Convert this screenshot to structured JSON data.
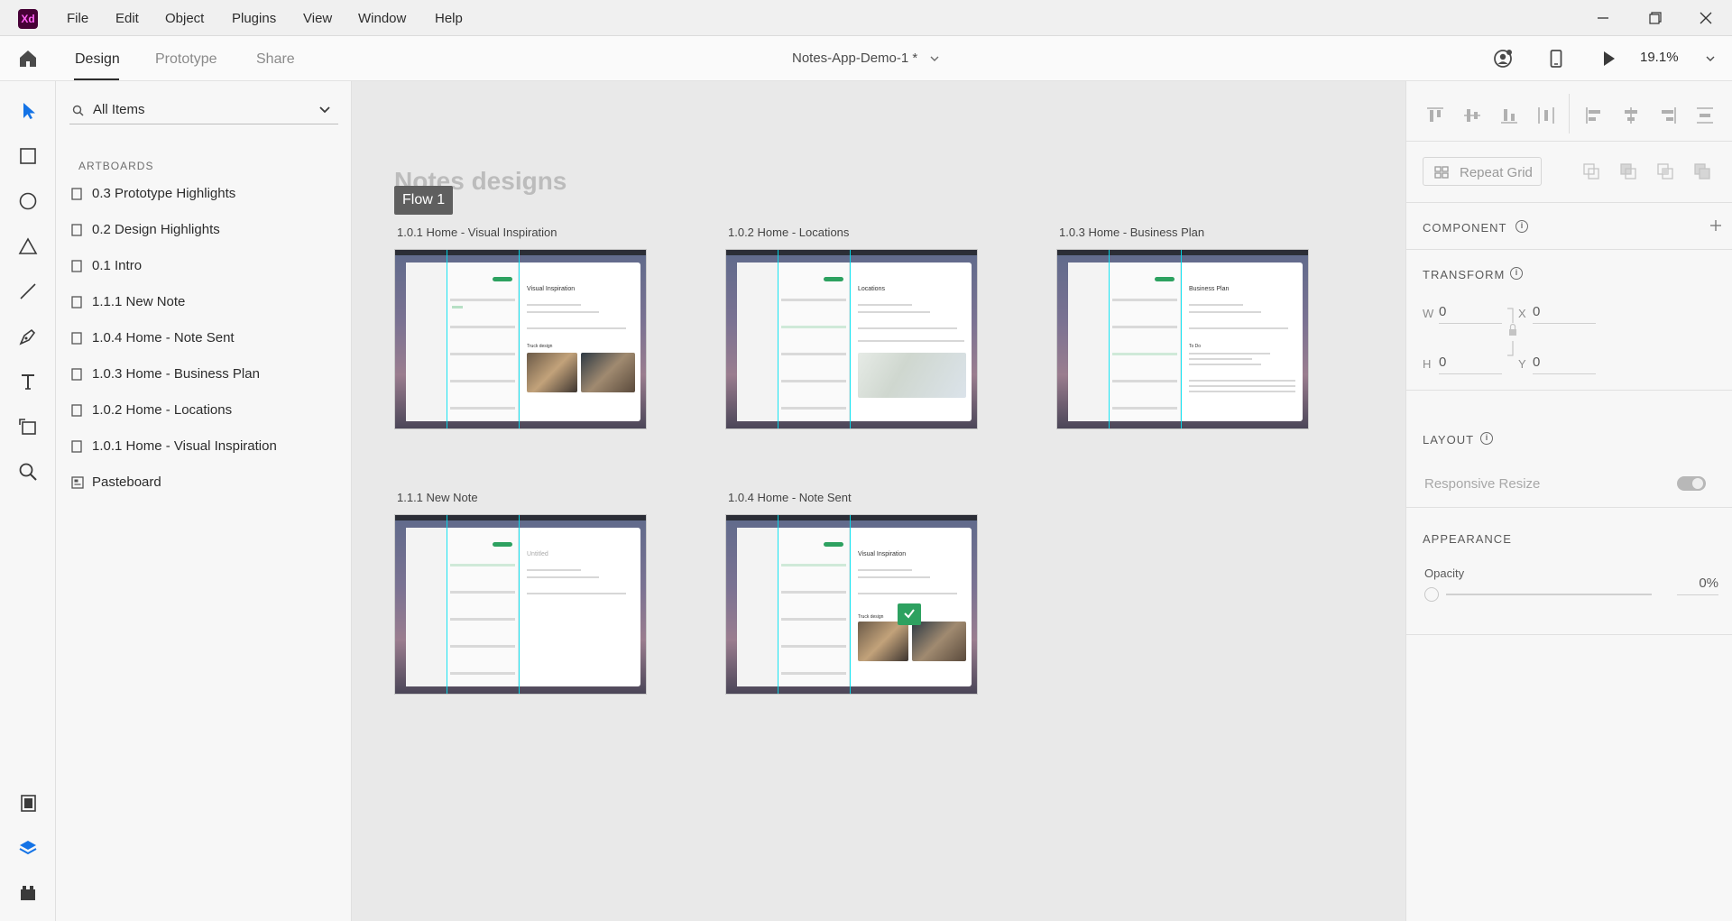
{
  "app": {
    "logo": "Xd",
    "menu": [
      "File",
      "Edit",
      "Object",
      "Plugins",
      "View",
      "Window",
      "Help"
    ]
  },
  "modebar": {
    "tabs": [
      "Design",
      "Prototype",
      "Share"
    ],
    "document_title": "Notes-App-Demo-1 *",
    "zoom": "19.1%"
  },
  "tools": [
    "select-icon",
    "rectangle-icon",
    "ellipse-icon",
    "polygon-icon",
    "line-icon",
    "pen-icon",
    "text-icon",
    "artboard-icon",
    "zoom-icon",
    "assets-icon",
    "layers-icon",
    "plugins-icon"
  ],
  "layers_panel": {
    "filter_label": "All Items",
    "section": "ARTBOARDS",
    "items": [
      "0.3 Prototype Highlights",
      "0.2 Design Highlights",
      "0.1 Intro",
      "1.1.1 New Note",
      "1.0.4 Home - Note Sent",
      "1.0.3 Home - Business Plan",
      "1.0.2 Home - Locations",
      "1.0.1 Home - Visual Inspiration",
      "Pasteboard"
    ]
  },
  "canvas": {
    "heading": "Notes designs",
    "flow_badge": "Flow 1",
    "artboards": [
      {
        "label": "1.0.1 Home - Visual Inspiration",
        "note_title": "Visual Inspiration",
        "subhead": "Truck design",
        "has_images": true,
        "has_map": false
      },
      {
        "label": "1.0.2 Home - Locations",
        "note_title": "Locations",
        "subhead": "",
        "has_images": false,
        "has_map": true
      },
      {
        "label": "1.0.3 Home - Business Plan",
        "note_title": "Business Plan",
        "subhead": "To Do",
        "has_images": false,
        "has_map": false
      },
      {
        "label": "1.1.1 New Note",
        "note_title": "Untitled",
        "subhead": "",
        "has_images": false,
        "has_map": false
      },
      {
        "label": "1.0.4 Home - Note Sent",
        "note_title": "Visual Inspiration",
        "subhead": "Truck design",
        "has_images": true,
        "has_map": false
      }
    ]
  },
  "inspector": {
    "repeat_grid": "Repeat Grid",
    "component": "COMPONENT",
    "transform": "TRANSFORM",
    "w_label": "W",
    "w_value": "0",
    "h_label": "H",
    "h_value": "0",
    "x_label": "X",
    "x_value": "0",
    "y_label": "Y",
    "y_value": "0",
    "layout": "LAYOUT",
    "responsive_resize": "Responsive Resize",
    "appearance": "APPEARANCE",
    "opacity_label": "Opacity",
    "opacity_value": "0%"
  }
}
